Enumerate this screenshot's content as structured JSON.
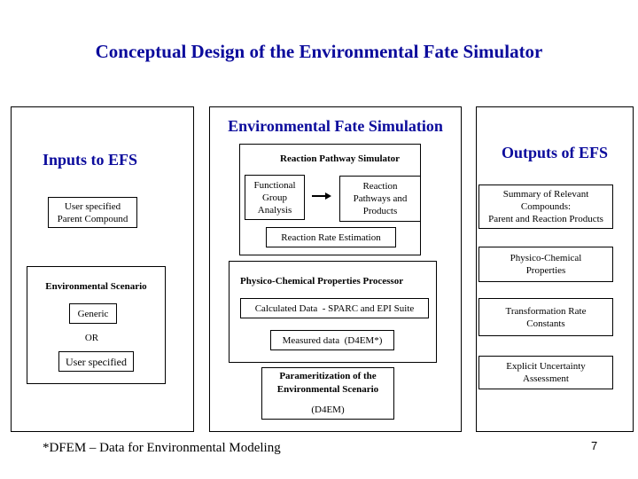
{
  "title": "Conceptual Design of the Environmental Fate Simulator",
  "inputs_panel": {
    "heading": "Inputs to EFS",
    "parent_compound": [
      "User specified",
      "Parent Compound"
    ],
    "environmental_scenario": {
      "heading": "Environmental Scenario",
      "option_generic": "Generic",
      "or_label": "OR",
      "option_user": "User specified"
    }
  },
  "simulation_panel": {
    "heading": "Environmental Fate Simulation",
    "reaction_pathway_simulator": {
      "heading": "Reaction Pathway Simulator",
      "functional_group": [
        "Functional",
        "Group",
        "Analysis"
      ],
      "reaction_pathways": [
        "Reaction",
        "Pathways and",
        "Products"
      ],
      "rate_estimation": "Reaction Rate Estimation"
    },
    "properties_processor": {
      "heading": "Physico-Chemical Properties Processor",
      "calculated": "Calculated Data  - SPARC and EPI Suite",
      "measured": "Measured data  (D4EM*)"
    },
    "parameterization": {
      "line1": "Parameritization of the",
      "line2": "Environmental Scenario",
      "line3": "(D4EM)"
    }
  },
  "outputs_panel": {
    "heading": "Outputs of EFS",
    "items": [
      [
        "Summary of Relevant",
        "Compounds:",
        "Parent and Reaction Products"
      ],
      [
        "Physico-Chemical",
        "Properties"
      ],
      [
        "Transformation Rate",
        "Constants"
      ],
      [
        "Explicit Uncertainty",
        "Assessment"
      ]
    ]
  },
  "footnote": "*DFEM – Data for Environmental Modeling",
  "page_number": "7"
}
